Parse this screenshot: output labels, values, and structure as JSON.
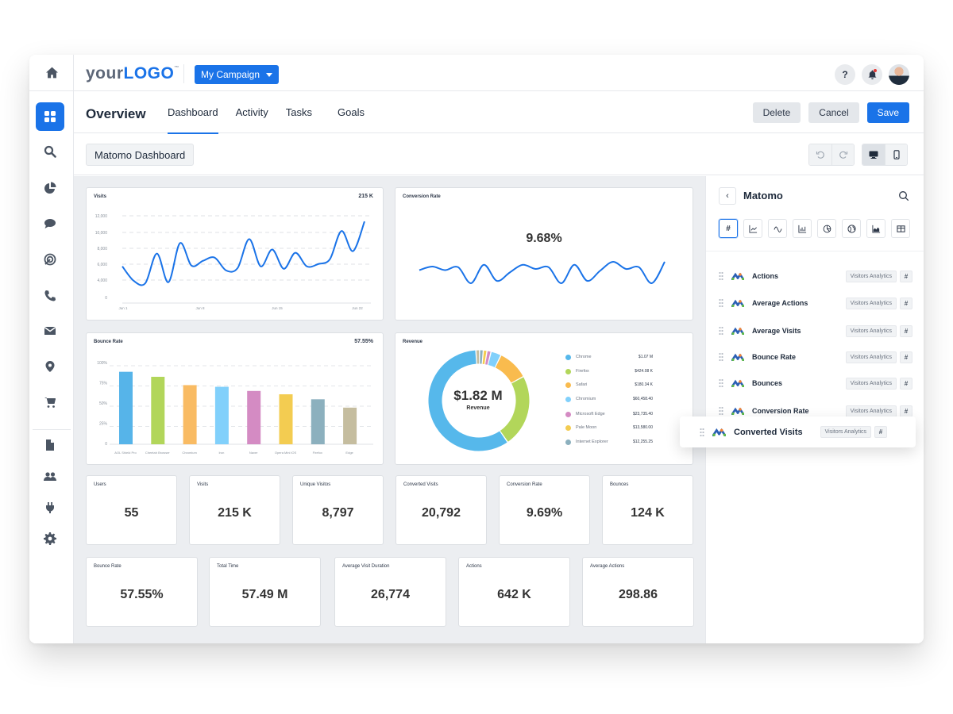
{
  "topbar": {
    "logo_your": "your",
    "logo_brand": "LOGO",
    "logo_tm": "™",
    "campaign_label": "My Campaign",
    "help_label": "?"
  },
  "subheader": {
    "title": "Overview",
    "tabs": [
      {
        "label": "Dashboard",
        "active": true
      },
      {
        "label": "Activity",
        "active": false
      },
      {
        "label": "Tasks",
        "active": false
      },
      {
        "label": "Goals",
        "active": false
      }
    ],
    "delete_label": "Delete",
    "cancel_label": "Cancel",
    "save_label": "Save"
  },
  "toolbar": {
    "dashboard_name": "Matomo Dashboard",
    "view_mode": "desktop"
  },
  "sidebar": {
    "items": [
      {
        "icon": "home-icon"
      },
      {
        "icon": "dashboard-grid-icon",
        "active": true
      },
      {
        "icon": "search-icon"
      },
      {
        "icon": "pie-chart-icon"
      },
      {
        "icon": "chat-bubble-icon"
      },
      {
        "icon": "target-icon"
      },
      {
        "icon": "phone-icon"
      },
      {
        "icon": "mail-icon"
      },
      {
        "icon": "location-pin-icon"
      },
      {
        "icon": "cart-icon"
      },
      {
        "icon": "document-icon"
      },
      {
        "icon": "users-icon"
      },
      {
        "icon": "plug-icon"
      },
      {
        "icon": "gear-icon"
      }
    ]
  },
  "widgets": {
    "visits": {
      "title": "Visits",
      "value": "215 K"
    },
    "conversion": {
      "title": "Conversion Rate",
      "value": "9.68%"
    },
    "bounce": {
      "title": "Bounce Rate",
      "value": "57.55%"
    },
    "revenue": {
      "title": "Revenue",
      "center_value": "$1.82 M",
      "center_label": "Revenue"
    }
  },
  "stats_row1": [
    {
      "label": "Users",
      "value": "55"
    },
    {
      "label": "Visits",
      "value": "215 K"
    },
    {
      "label": "Unique Visitos",
      "value": "8,797"
    },
    {
      "label": "Converted Visits",
      "value": "20,792"
    },
    {
      "label": "Conversion Rate",
      "value": "9.69%"
    },
    {
      "label": "Bounces",
      "value": "124 K"
    }
  ],
  "stats_row2": [
    {
      "label": "Bounce Rate",
      "value": "57.55%"
    },
    {
      "label": "Total Time",
      "value": "57.49 M"
    },
    {
      "label": "Average Visit Duration",
      "value": "26,774"
    },
    {
      "label": "Actions",
      "value": "642 K"
    },
    {
      "label": "Average Actions",
      "value": "298.86"
    }
  ],
  "panel": {
    "title": "Matomo",
    "viz_types": [
      "number",
      "line-chart",
      "sparkline",
      "bar-chart",
      "pie-chart",
      "map",
      "area-chart",
      "table"
    ],
    "metrics": [
      {
        "name": "Actions",
        "tag": "Visitors Analytics",
        "type": "#"
      },
      {
        "name": "Average Actions",
        "tag": "Visitors Analytics",
        "type": "#"
      },
      {
        "name": "Average Visits",
        "tag": "Visitors Analytics",
        "type": "#"
      },
      {
        "name": "Bounce Rate",
        "tag": "Visitors Analytics",
        "type": "#"
      },
      {
        "name": "Bounces",
        "tag": "Visitors Analytics",
        "type": "#"
      },
      {
        "name": "Conversion Rate",
        "tag": "Visitors Analytics",
        "type": "#"
      }
    ],
    "dragging": {
      "name": "Converted Visits",
      "tag": "Visitors Analytics",
      "type": "#"
    }
  },
  "colors": {
    "accent": "#1a73e8",
    "line": "#1a73e8"
  },
  "chart_data": [
    {
      "type": "line",
      "title": "Visits",
      "x_ticks": [
        "Jun 1",
        "Jun 8",
        "Jun 15",
        "Jun 22"
      ],
      "y_ticks": [
        "0",
        "4,000",
        "6,000",
        "8,000",
        "10,000",
        "12,000"
      ],
      "ylim": [
        0,
        12000
      ],
      "values": [
        5700,
        3800,
        3300,
        7300,
        3500,
        8600,
        5800,
        6400,
        6800,
        5200,
        5500,
        9100,
        5700,
        7800,
        5400,
        7400,
        5700,
        6000,
        6600,
        10100,
        7600,
        11300
      ]
    },
    {
      "type": "line",
      "title": "Conversion Rate",
      "headline": "9.68%",
      "values": [
        5.0,
        5.6,
        5.0,
        5.5,
        2.8,
        5.9,
        3.2,
        4.6,
        5.9,
        5.2,
        5.5,
        2.8,
        5.9,
        3.2,
        4.9,
        6.4,
        5.2,
        5.5,
        2.8,
        6.4
      ]
    },
    {
      "type": "bar",
      "title": "Bounce Rate",
      "headline": "57.55%",
      "categories": [
        "AOL Shield Pro",
        "Cheetah Browser",
        "Chromium",
        "Iron",
        "Naver",
        "Opera Mini iOS",
        "Firefox",
        "Edge"
      ],
      "values": [
        87,
        81,
        71,
        69,
        64,
        60,
        54,
        44
      ],
      "colors": [
        "#56b4e9",
        "#b2d65a",
        "#f9bb63",
        "#81d0fb",
        "#d48bc3",
        "#f3cc51",
        "#8cb0be",
        "#c5bd9f"
      ],
      "y_ticks": [
        "0",
        "25%",
        "50%",
        "75%",
        "100%"
      ],
      "ylim": [
        0,
        100
      ]
    },
    {
      "type": "pie",
      "title": "Revenue",
      "total": "$1.82 M",
      "labels": [
        "Chrome",
        "Firefox",
        "Safari",
        "Chromium",
        "Microsoft Edge",
        "Pale Moon",
        "Internet Explorer"
      ],
      "display_values": [
        "$1.07 M",
        "$424.08 K",
        "$180.34 K",
        "$60,458.40",
        "$23,735.40",
        "$13,580.00",
        "$12,255.25"
      ],
      "values": [
        1070000,
        424080,
        180340,
        60458.4,
        23735.4,
        13580,
        12255.25,
        9000
      ],
      "colors": [
        "#56b8eb",
        "#b2d65a",
        "#f9bb4e",
        "#81d0fb",
        "#d48bc3",
        "#f3cc51",
        "#8cb0be",
        "#c5bd9f"
      ]
    }
  ]
}
